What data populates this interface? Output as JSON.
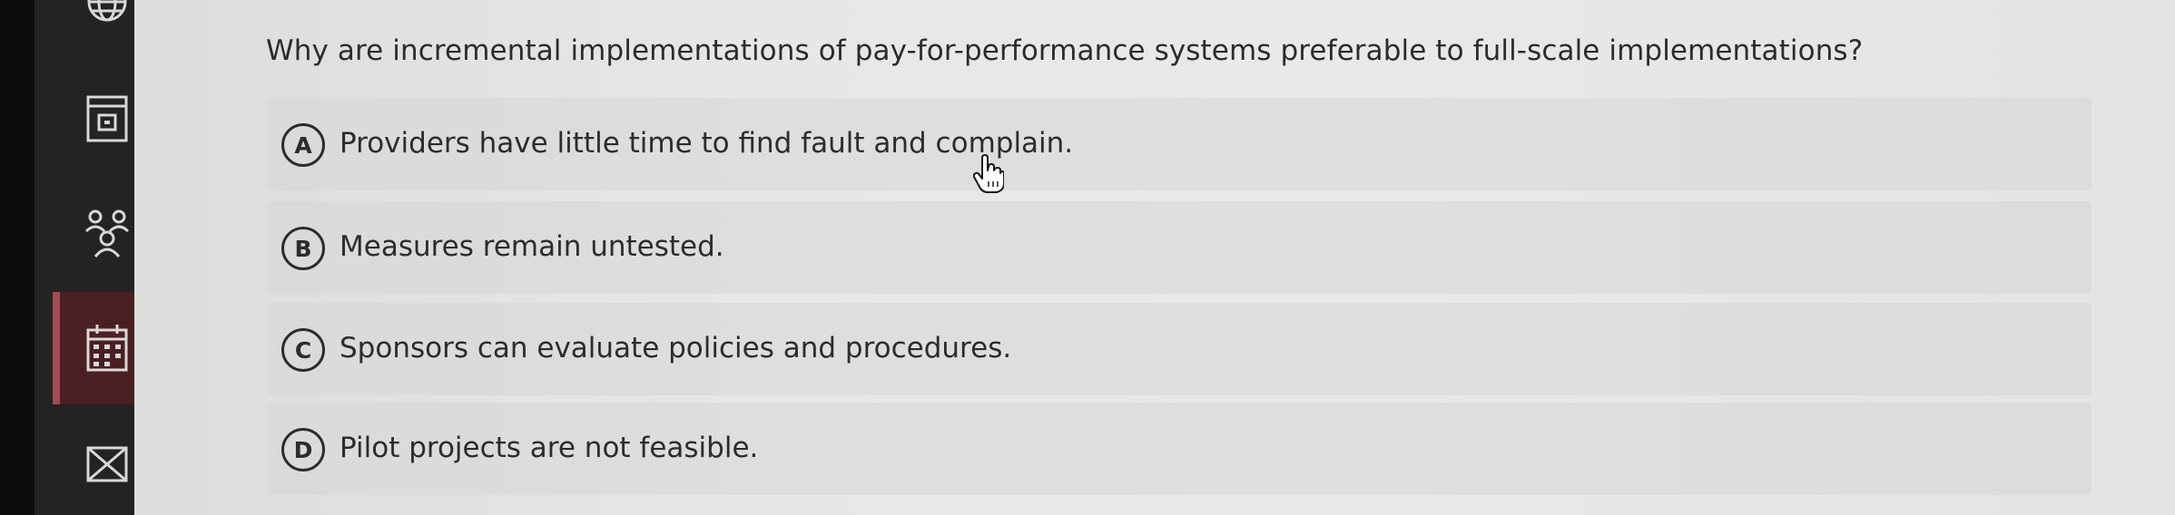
{
  "sidebar": {
    "icons": [
      "globe-icon",
      "calendar-icon",
      "people-icon",
      "schedule-icon",
      "mail-icon"
    ],
    "active_index": 3,
    "active_color": "#4a1f22"
  },
  "question": {
    "text": "Why are incremental implementations of pay-for-performance systems preferable to full-scale implementations?"
  },
  "options": [
    {
      "letter": "A",
      "text": "Providers have little time to find fault and complain."
    },
    {
      "letter": "B",
      "text": "Measures remain untested."
    },
    {
      "letter": "C",
      "text": "Sponsors can evaluate policies and procedures."
    },
    {
      "letter": "D",
      "text": "Pilot projects are not feasible."
    }
  ],
  "cursor": {
    "type": "hand-pointer-icon"
  }
}
